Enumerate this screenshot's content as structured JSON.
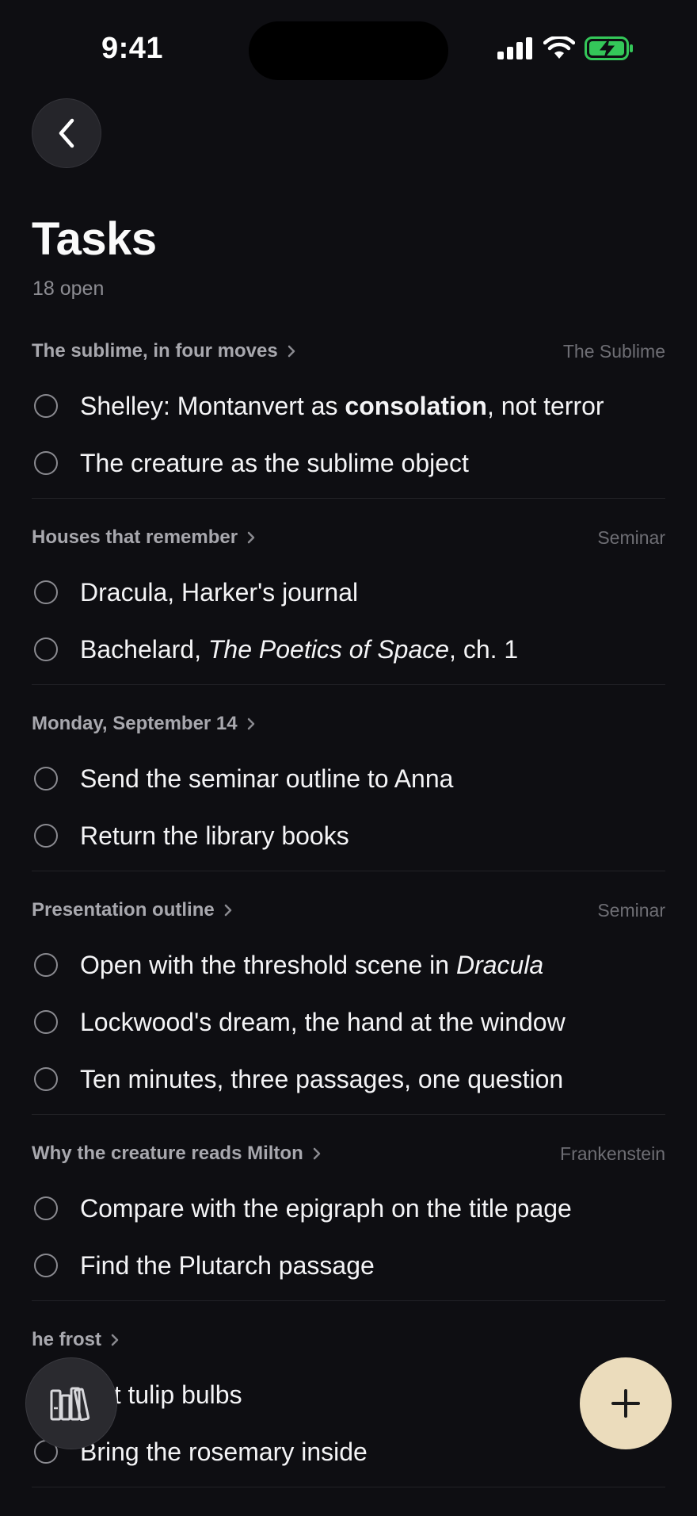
{
  "status_bar": {
    "time": "9:41"
  },
  "header": {
    "title": "Tasks",
    "subtitle": "18 open"
  },
  "groups": [
    {
      "title": "The sublime, in four moves",
      "tag": "The Sublime",
      "tasks": [
        {
          "parts": [
            {
              "t": "Shelley: Montanvert as "
            },
            {
              "t": "consolation",
              "s": "bold"
            },
            {
              "t": ", not terror"
            }
          ]
        },
        {
          "parts": [
            {
              "t": "The creature as the sublime object"
            }
          ]
        }
      ]
    },
    {
      "title": "Houses that remember",
      "tag": "Seminar",
      "tasks": [
        {
          "parts": [
            {
              "t": "Dracula, Harker's journal"
            }
          ]
        },
        {
          "parts": [
            {
              "t": "Bachelard, "
            },
            {
              "t": "The Poetics of Space",
              "s": "italic"
            },
            {
              "t": ", ch. 1"
            }
          ]
        }
      ]
    },
    {
      "title": "Monday, September 14",
      "tag": "",
      "tasks": [
        {
          "parts": [
            {
              "t": "Send the seminar outline to Anna"
            }
          ]
        },
        {
          "parts": [
            {
              "t": "Return the library books"
            }
          ]
        }
      ]
    },
    {
      "title": "Presentation outline",
      "tag": "Seminar",
      "tasks": [
        {
          "parts": [
            {
              "t": "Open with the threshold scene in "
            },
            {
              "t": "Dracula",
              "s": "italic"
            }
          ]
        },
        {
          "parts": [
            {
              "t": "Lockwood's dream, the hand at the window"
            }
          ]
        },
        {
          "parts": [
            {
              "t": "Ten minutes, three passages, one question"
            }
          ]
        }
      ]
    },
    {
      "title": "Why the creature reads Milton",
      "tag": "Frankenstein",
      "tasks": [
        {
          "parts": [
            {
              "t": "Compare with the epigraph on the title page"
            }
          ]
        },
        {
          "parts": [
            {
              "t": "Find the Plutarch passage"
            }
          ]
        }
      ]
    },
    {
      "title": "he frost",
      "tag": "",
      "tasks": [
        {
          "parts": [
            {
              "t": "lant tulip bulbs"
            }
          ]
        },
        {
          "parts": [
            {
              "t": "Bring the rosemary inside"
            }
          ]
        }
      ]
    }
  ],
  "icons": {
    "back": "chevron-left-icon",
    "library": "books-icon",
    "add": "plus-icon"
  },
  "colors": {
    "background": "#0e0e12",
    "add_button": "#ebdcbc",
    "battery_green": "#34c759"
  }
}
